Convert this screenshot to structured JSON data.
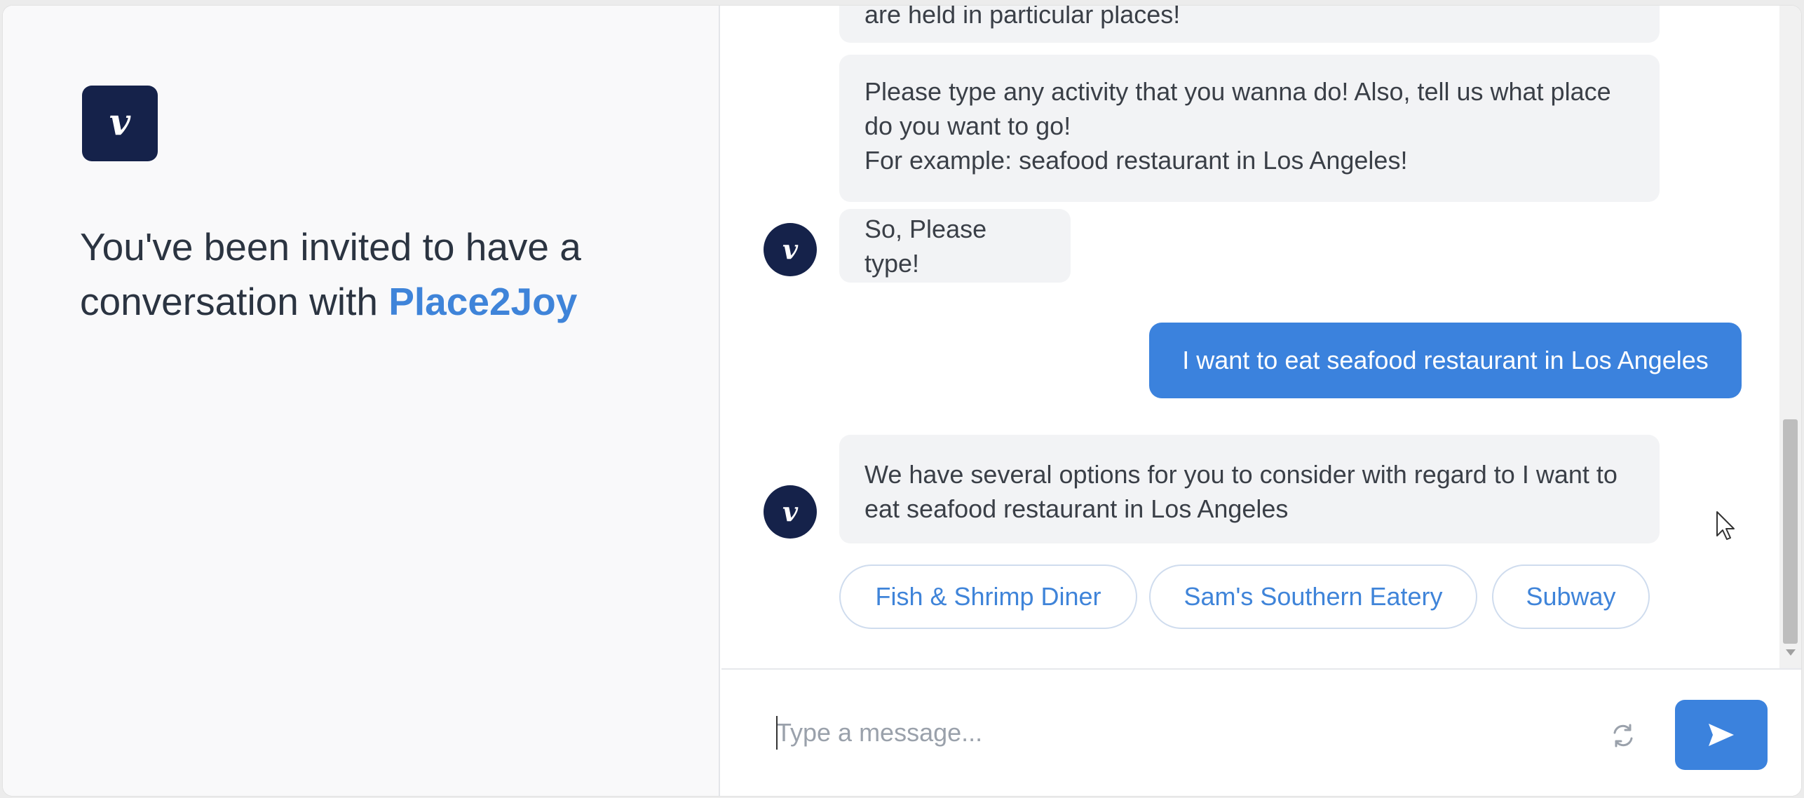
{
  "intro": {
    "logo_letter": "v",
    "text_prefix": "You've been invited to have a conversation with ",
    "brand": "Place2Joy"
  },
  "messages": {
    "partial": "are held in particular places!",
    "prompt_lines": [
      "Please type any activity that you wanna do! Also, tell us what place",
      "do you want to go!",
      "For example: seafood restaurant in Los Angeles!"
    ],
    "type_prompt": "So, Please type!",
    "user_message": "I want to eat seafood restaurant in Los Angeles",
    "options_text": "We have several options for you to consider with regard to I want to eat seafood restaurant in Los Angeles",
    "options": [
      "Fish & Shrimp Diner",
      "Sam's Southern Eatery",
      "Subway"
    ]
  },
  "composer": {
    "placeholder": "Type a message..."
  },
  "icons": {
    "logo": "v-logo-icon",
    "refresh": "refresh-icon",
    "send": "send-icon",
    "cursor": "mouse-cursor-icon"
  },
  "colors": {
    "brand_navy": "#15224a",
    "accent_blue": "#3b82dd",
    "link_blue": "#3f84d9",
    "bubble_gray": "#f2f3f5"
  }
}
